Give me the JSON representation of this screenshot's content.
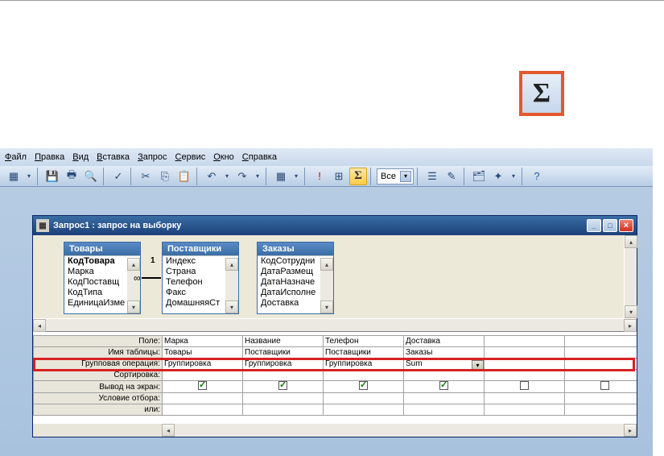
{
  "sigma_glyph": "Σ",
  "menubar": {
    "items": [
      "Файл",
      "Правка",
      "Вид",
      "Вставка",
      "Запрос",
      "Сервис",
      "Окно",
      "Справка"
    ]
  },
  "toolbar": {
    "combo_value": "Все"
  },
  "querywin": {
    "title": "Запрос1 : запрос на выборку",
    "tables": [
      {
        "name": "Товары",
        "fields": [
          "КодТовара",
          "Марка",
          "КодПоставщ",
          "КодТипа",
          "ЕдиницаИзме"
        ],
        "bold_field_index": 0
      },
      {
        "name": "Поставщики",
        "fields": [
          "Индекс",
          "Страна",
          "Телефон",
          "Факс",
          "ДомашняяСт"
        ],
        "bold_field_index": -1
      },
      {
        "name": "Заказы",
        "fields": [
          "КодСотрудни",
          "ДатаРазмещ",
          "ДатаНазначе",
          "ДатаИсполне",
          "Доставка"
        ],
        "bold_field_index": -1
      }
    ],
    "join_label_top": "1",
    "join_label_bottom": "∞"
  },
  "grid": {
    "row_labels": {
      "field": "Поле:",
      "table": "Имя таблицы:",
      "total": "Групповая операция:",
      "sort": "Сортировка:",
      "show": "Вывод на экран:",
      "criteria": "Условие отбора:",
      "or": "или:"
    },
    "columns": [
      {
        "field": "Марка",
        "table": "Товары",
        "total": "Группировка",
        "show": true
      },
      {
        "field": "Название",
        "table": "Поставщики",
        "total": "Группировка",
        "show": true
      },
      {
        "field": "Телефон",
        "table": "Поставщики",
        "total": "Группировка",
        "show": true
      },
      {
        "field": "Доставка",
        "table": "Заказы",
        "total": "Sum",
        "show": true,
        "dropdown": true
      },
      {
        "field": "",
        "table": "",
        "total": "",
        "show": false
      },
      {
        "field": "",
        "table": "",
        "total": "",
        "show": false
      }
    ]
  }
}
